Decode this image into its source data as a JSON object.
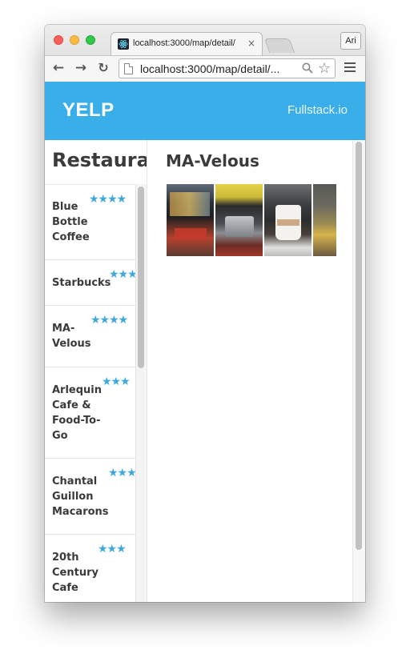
{
  "browser": {
    "tab_title": "localhost:3000/map/detail/",
    "tab_close": "×",
    "profile_label": "Ari",
    "url": "localhost:3000/map/detail/...",
    "back_icon": "←",
    "forward_icon": "→",
    "reload_icon": "↻",
    "zoom_icon": "🔍",
    "star_icon": "☆"
  },
  "header": {
    "logo": "YELP",
    "link": "Fullstack.io"
  },
  "sidebar": {
    "title": "Restaurants",
    "items": [
      {
        "name": "Blue\nBottle\nCoffee",
        "stars": "★★★★",
        "rating": 4
      },
      {
        "name": "Starbucks",
        "stars": "★★★",
        "rating": 3
      },
      {
        "name": "MA-\nVelous",
        "stars": "★★★★",
        "rating": 4
      },
      {
        "name": "Arlequin\nCafe &\nFood-To-\nGo",
        "stars": "★★★",
        "rating": 3
      },
      {
        "name": "Chantal\nGuillon\nMacarons",
        "stars": "★★★",
        "rating": 3
      },
      {
        "name": "20th\nCentury\nCafe",
        "stars": "★★★",
        "rating": 3
      }
    ]
  },
  "detail": {
    "title": "MA-Velous",
    "photo_count": 4
  },
  "colors": {
    "header": "#3aaee8",
    "stars": "#3ea8dd"
  }
}
